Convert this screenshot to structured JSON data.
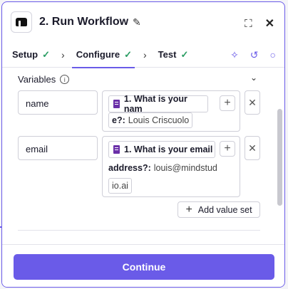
{
  "header": {
    "title": "2. Run Workflow"
  },
  "tabs": [
    {
      "label": "Setup",
      "done": true
    },
    {
      "label": "Configure",
      "done": true
    },
    {
      "label": "Test",
      "done": true
    }
  ],
  "variables": {
    "label": "Variables",
    "rows": [
      {
        "name": "name",
        "chip_label": "1. What is your nam",
        "answer_key": "e?:",
        "answer_value": "Louis Criscuolo"
      },
      {
        "name": "email",
        "chip_label": "1. What is your email",
        "answer_key": "address?:",
        "answer_value_1": "louis@mindstud",
        "answer_value_2": "io.ai"
      }
    ],
    "add_value_set": "Add value set"
  },
  "footer": {
    "continue_label": "Continue"
  },
  "colors": {
    "accent": "#6a5be8",
    "check": "#2a9d63",
    "doc": "#6a2fa8"
  }
}
